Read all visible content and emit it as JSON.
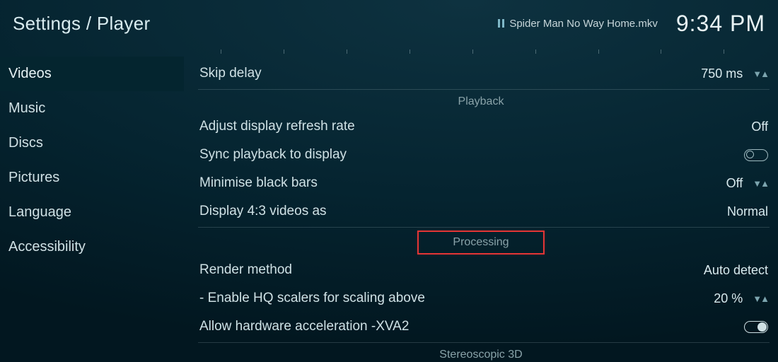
{
  "header": {
    "breadcrumb": "Settings / Player",
    "now_playing": "Spider Man No Way Home.mkv",
    "clock": "9:34 PM"
  },
  "sidebar": {
    "items": [
      {
        "id": "videos",
        "label": "Videos",
        "active": true
      },
      {
        "id": "music",
        "label": "Music",
        "active": false
      },
      {
        "id": "discs",
        "label": "Discs",
        "active": false
      },
      {
        "id": "pictures",
        "label": "Pictures",
        "active": false
      },
      {
        "id": "language",
        "label": "Language",
        "active": false
      },
      {
        "id": "accessibility",
        "label": "Accessibility",
        "active": false
      }
    ]
  },
  "content": {
    "rows": [
      {
        "label": "Skip delay",
        "value": "750 ms",
        "spinner": true
      }
    ],
    "section_playback": {
      "title": "Playback",
      "rows": [
        {
          "label": "Adjust display refresh rate",
          "value": "Off"
        },
        {
          "label": "Sync playback to display",
          "toggle": "off"
        },
        {
          "label": "Minimise black bars",
          "value": "Off",
          "spinner": true
        },
        {
          "label": "Display 4:3 videos as",
          "value": "Normal"
        }
      ]
    },
    "section_processing": {
      "title": "Processing",
      "highlighted": true,
      "rows": [
        {
          "label": "Render method",
          "value": "Auto detect"
        },
        {
          "label": "- Enable HQ scalers for scaling above",
          "value": "20 %",
          "spinner": true
        },
        {
          "label": "Allow hardware acceleration -XVA2",
          "toggle": "on"
        }
      ]
    },
    "section_stereo": {
      "title": "Stereoscopic 3D"
    }
  }
}
